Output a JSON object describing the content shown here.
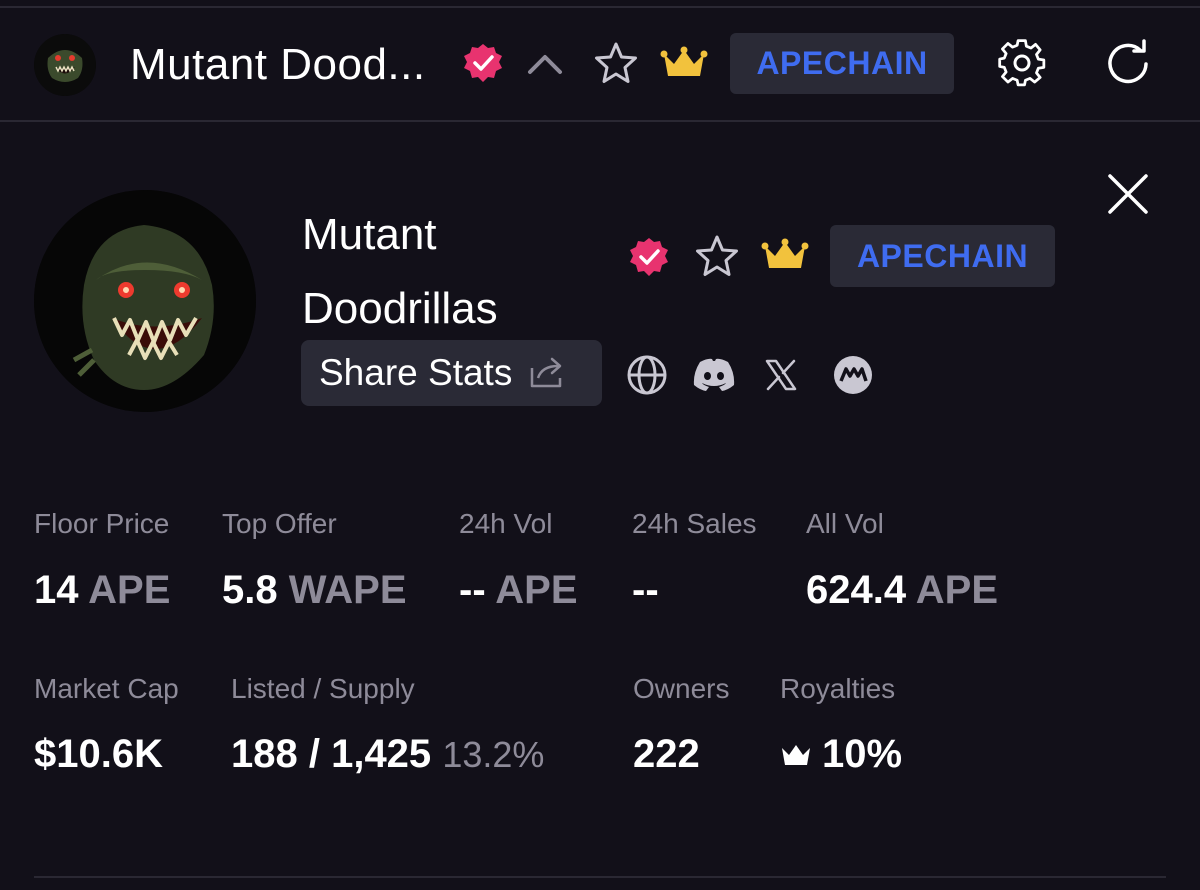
{
  "colors": {
    "background": "#121019",
    "pill_background": "#2a2a36",
    "chain_blue": "#3f6cf0",
    "verified_pink": "#e8336f",
    "crown_gold": "#f2c23d",
    "muted_text": "#8e8b99"
  },
  "header": {
    "title": "Mutant Dood...",
    "chain": "APECHAIN",
    "icons": [
      "collection-avatar",
      "verified-badge-icon",
      "chevron-up-icon",
      "star-icon",
      "crown-icon",
      "gear-icon",
      "refresh-icon"
    ]
  },
  "collection": {
    "name": "Mutant Doodrillas",
    "chain": "APECHAIN",
    "share_label": "Share Stats",
    "links": [
      "globe-icon",
      "discord-icon",
      "x-icon",
      "magic-eden-icon"
    ]
  },
  "stats": {
    "floor": {
      "label": "Floor Price",
      "value": "14",
      "unit": "APE"
    },
    "top_offer": {
      "label": "Top Offer",
      "value": "5.8",
      "unit": "WAPE"
    },
    "vol_24h": {
      "label": "24h Vol",
      "value": "--",
      "unit": "APE"
    },
    "sales_24h": {
      "label": "24h Sales",
      "value": "--"
    },
    "all_vol": {
      "label": "All Vol",
      "value": "624.4",
      "unit": "APE"
    },
    "market_cap": {
      "label": "Market Cap",
      "value": "$10.6K"
    },
    "listed_supply": {
      "label": "Listed / Supply",
      "value": "188 / 1,425",
      "percent": "13.2%"
    },
    "owners": {
      "label": "Owners",
      "value": "222"
    },
    "royalties": {
      "label": "Royalties",
      "value": "10%"
    }
  }
}
